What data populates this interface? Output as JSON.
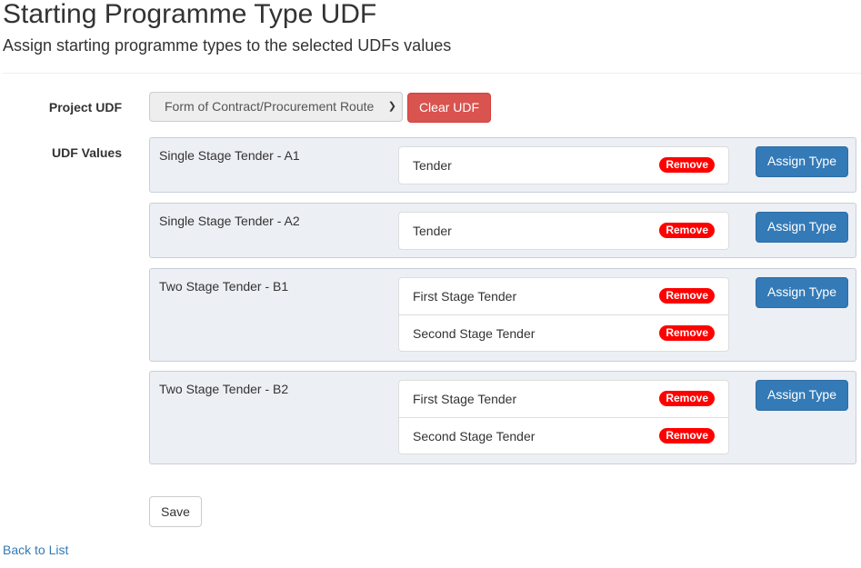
{
  "header": {
    "title": "Starting Programme Type UDF",
    "subtitle": "Assign starting programme types to the selected UDFs values"
  },
  "form": {
    "project_udf_label": "Project UDF",
    "project_udf_selected": "Form of Contract/Procurement Route",
    "clear_udf_label": "Clear UDF",
    "udf_values_label": "UDF Values",
    "chevron_icon": "chevron-down-icon",
    "udf_values": [
      {
        "name": "Single Stage Tender - A1",
        "types": [
          "Tender"
        ],
        "remove_label": "Remove",
        "assign_label": "Assign Type"
      },
      {
        "name": "Single Stage Tender - A2",
        "types": [
          "Tender"
        ],
        "remove_label": "Remove",
        "assign_label": "Assign Type"
      },
      {
        "name": "Two Stage Tender - B1",
        "types": [
          "First Stage Tender",
          "Second Stage Tender"
        ],
        "remove_label": "Remove",
        "assign_label": "Assign Type"
      },
      {
        "name": "Two Stage Tender - B2",
        "types": [
          "First Stage Tender",
          "Second Stage Tender"
        ],
        "remove_label": "Remove",
        "assign_label": "Assign Type"
      }
    ],
    "save_label": "Save"
  },
  "footer": {
    "back_link": "Back to List"
  },
  "colors": {
    "primary": "#337ab7",
    "danger": "#d9534f",
    "badge_red": "#ff0000",
    "row_bg": "#eceff4"
  }
}
